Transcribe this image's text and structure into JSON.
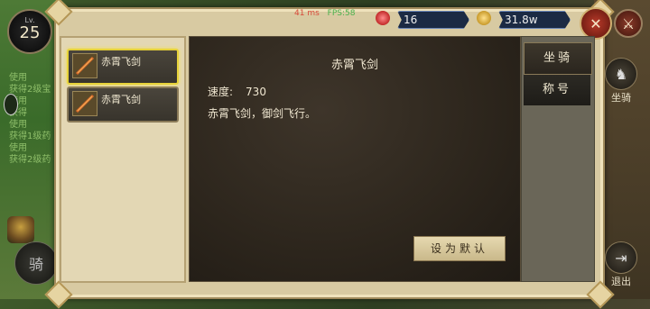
{
  "hud": {
    "level_label": "Lv.",
    "level": "25",
    "latency": "41 ms",
    "fps": "FPS:58",
    "gems": "16",
    "gold": "31.8w"
  },
  "chat": [
    {
      "verb": "使用",
      "rest": ""
    },
    {
      "verb": "获得",
      "rest": "2级宝"
    },
    {
      "verb": "使用",
      "rest": ""
    },
    {
      "verb": "获得",
      "rest": ""
    },
    {
      "verb": "使用",
      "rest": ""
    },
    {
      "verb": "获得",
      "rest": "1级药"
    },
    {
      "verb": "使用",
      "rest": ""
    },
    {
      "verb": "获得",
      "rest": "2级药"
    }
  ],
  "left_buttons": {
    "ride": "骑"
  },
  "right_buttons": {
    "mount": "坐骑",
    "exit": "退出"
  },
  "list": {
    "items": [
      {
        "name": "赤霄飞剑",
        "selected": true
      },
      {
        "name": "赤霄飞剑",
        "selected": false
      }
    ]
  },
  "detail": {
    "title": "赤霄飞剑",
    "speed_label": "速度:",
    "speed_value": "730",
    "description": "赤霄飞剑，御剑飞行。",
    "default_button": "设为默认"
  },
  "tabs": [
    {
      "label": "坐骑",
      "active": true
    },
    {
      "label": "称号",
      "active": false
    }
  ],
  "colors": {
    "panel": "#d8caa2",
    "detail_bg": "#2c251c",
    "selected_border": "#e6d23a",
    "close_button": "#b83a2a"
  }
}
